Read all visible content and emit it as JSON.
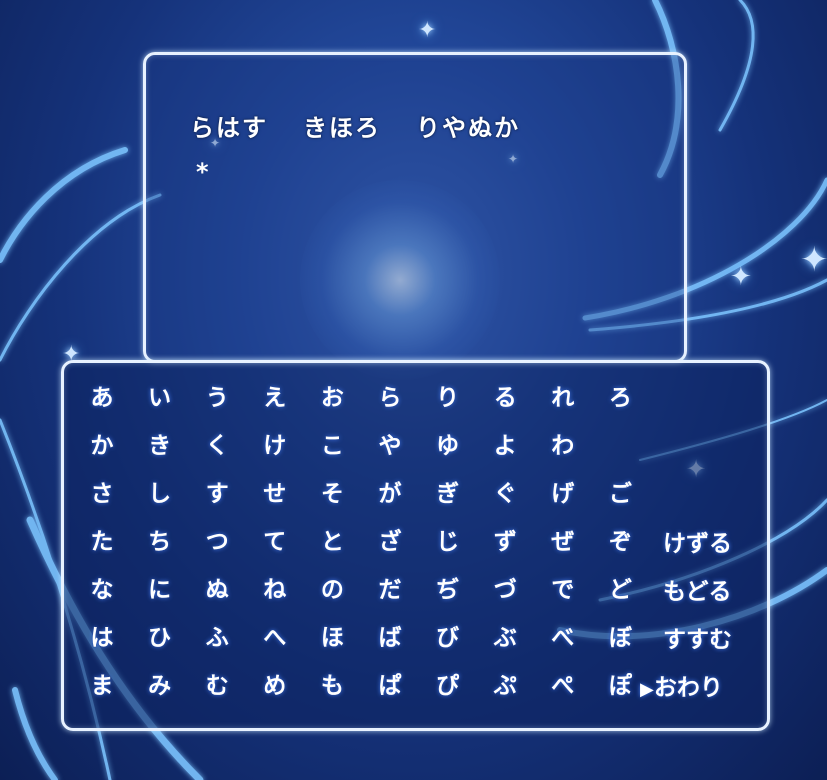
{
  "entry": {
    "words": [
      "らはす",
      "きほろ",
      "りやぬか"
    ],
    "cursor": "*"
  },
  "keyboard": {
    "rows": [
      [
        "あ",
        "い",
        "う",
        "え",
        "お",
        "ら",
        "り",
        "る",
        "れ",
        "ろ"
      ],
      [
        "か",
        "き",
        "く",
        "け",
        "こ",
        "や",
        "ゆ",
        "よ",
        "わ",
        ""
      ],
      [
        "さ",
        "し",
        "す",
        "せ",
        "そ",
        "が",
        "ぎ",
        "ぐ",
        "げ",
        "ご"
      ],
      [
        "た",
        "ち",
        "つ",
        "て",
        "と",
        "ざ",
        "じ",
        "ず",
        "ぜ",
        "ぞ"
      ],
      [
        "な",
        "に",
        "ぬ",
        "ね",
        "の",
        "だ",
        "ぢ",
        "づ",
        "で",
        "ど"
      ],
      [
        "は",
        "ひ",
        "ふ",
        "へ",
        "ほ",
        "ば",
        "び",
        "ぶ",
        "べ",
        "ぼ"
      ],
      [
        "ま",
        "み",
        "む",
        "め",
        "も",
        "ぱ",
        "ぴ",
        "ぷ",
        "ぺ",
        "ぽ"
      ]
    ],
    "commands": {
      "delete": "けずる",
      "back": "もどる",
      "forward": "すすむ",
      "end": "おわり",
      "selector": "▶"
    }
  },
  "colors": {
    "panel_border": "#e8f2ff",
    "text": "#ffffff",
    "background": "#15327a"
  }
}
